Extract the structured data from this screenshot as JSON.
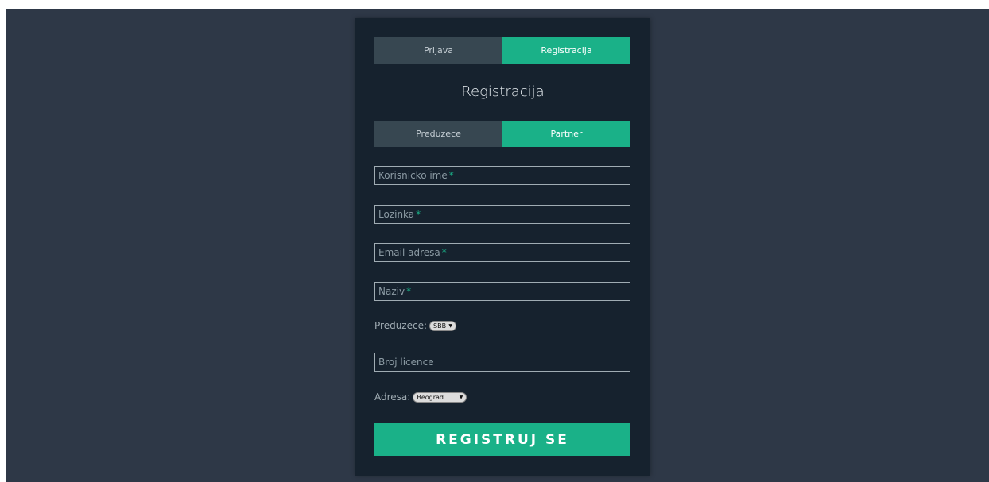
{
  "tabs": {
    "login": "Prijava",
    "register": "Registracija"
  },
  "title": "Registracija",
  "subtabs": {
    "company": "Preduzece",
    "partner": "Partner"
  },
  "fields": {
    "username": "Korisnicko ime",
    "password": "Lozinka",
    "email": "Email adresa",
    "name": "Naziv",
    "license": "Broj licence",
    "required_mark": "*"
  },
  "company_select": {
    "label": "Preduzece:",
    "value": "SBB"
  },
  "address_select": {
    "label": "Adresa:",
    "value": "Beograd"
  },
  "submit_label": "REGISTRUJ SE",
  "colors": {
    "accent": "#1ab188",
    "card": "#16222e",
    "background": "#2e3847"
  }
}
